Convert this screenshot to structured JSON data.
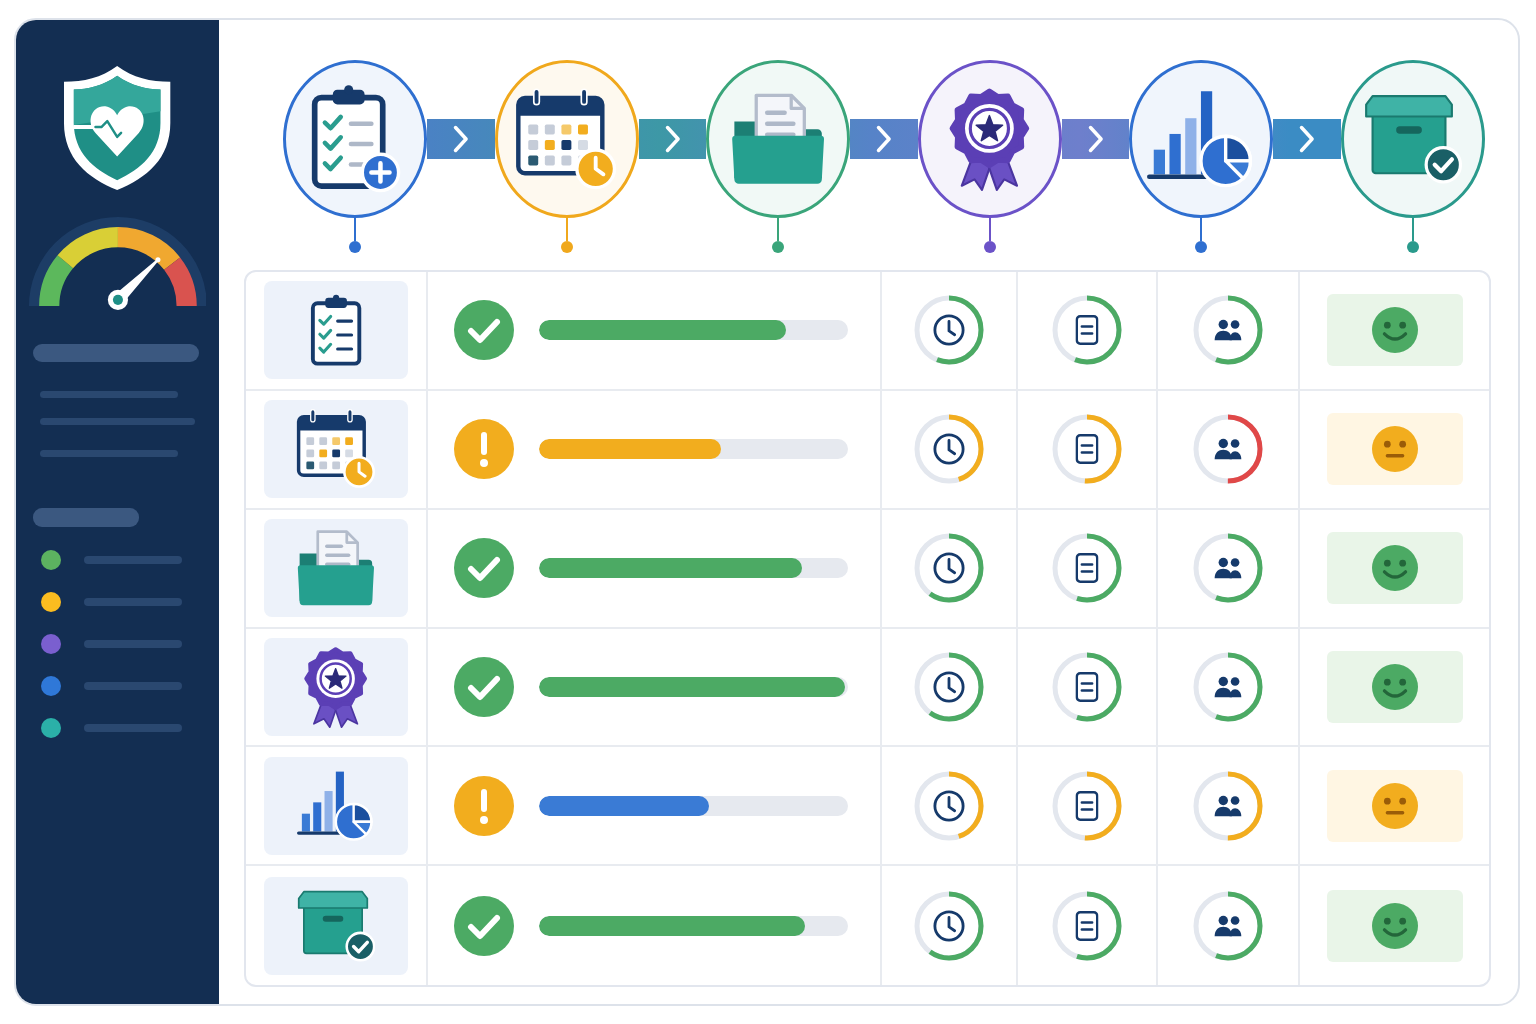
{
  "sidebar": {
    "gauge": {
      "level": 0.75
    },
    "legend": [
      {
        "color": "#5cb260"
      },
      {
        "color": "#fbbc20"
      },
      {
        "color": "#7a5fcf"
      },
      {
        "color": "#2f78d8"
      },
      {
        "color": "#2bb0a8"
      }
    ]
  },
  "pipeline": {
    "steps": [
      {
        "kind": "clipboard",
        "color": "#2f6fd0"
      },
      {
        "kind": "calendar",
        "color": "#f0a81c"
      },
      {
        "kind": "folder",
        "color": "#3aa57a"
      },
      {
        "kind": "award",
        "color": "#6b52c8"
      },
      {
        "kind": "chart",
        "color": "#2f6fd0"
      },
      {
        "kind": "archive",
        "color": "#2a9a8c"
      }
    ]
  },
  "table": {
    "rows": [
      {
        "icon": {
          "kind": "clipboard"
        },
        "status": {
          "kind": "check"
        },
        "progress": {
          "level": 0.8,
          "color": "#4caa64"
        },
        "rings": [
          {
            "kind": "clock",
            "level": 0.56,
            "color": "#4caa64"
          },
          {
            "kind": "document",
            "level": 0.56,
            "color": "#4caa64"
          },
          {
            "kind": "people",
            "level": 0.56,
            "color": "#4caa64"
          }
        ],
        "mood": {
          "kind": "happy"
        }
      },
      {
        "icon": {
          "kind": "calendar"
        },
        "status": {
          "kind": "alert"
        },
        "progress": {
          "level": 0.59,
          "color": "#f2ad1e"
        },
        "rings": [
          {
            "kind": "clock",
            "level": 0.45,
            "color": "#f2ad1e"
          },
          {
            "kind": "document",
            "level": 0.51,
            "color": "#f2ad1e"
          },
          {
            "kind": "people",
            "level": 0.5,
            "color": "#e04848"
          }
        ],
        "mood": {
          "kind": "neutral"
        }
      },
      {
        "icon": {
          "kind": "folder"
        },
        "status": {
          "kind": "check"
        },
        "progress": {
          "level": 0.85,
          "color": "#4caa64"
        },
        "rings": [
          {
            "kind": "clock",
            "level": 0.6,
            "color": "#4caa64"
          },
          {
            "kind": "document",
            "level": 0.55,
            "color": "#4caa64"
          },
          {
            "kind": "people",
            "level": 0.56,
            "color": "#4caa64"
          }
        ],
        "mood": {
          "kind": "happy"
        }
      },
      {
        "icon": {
          "kind": "award"
        },
        "status": {
          "kind": "check"
        },
        "progress": {
          "level": 0.99,
          "color": "#4caa64"
        },
        "rings": [
          {
            "kind": "clock",
            "level": 0.6,
            "color": "#4caa64"
          },
          {
            "kind": "document",
            "level": 0.55,
            "color": "#4caa64"
          },
          {
            "kind": "people",
            "level": 0.56,
            "color": "#4caa64"
          }
        ],
        "mood": {
          "kind": "happy"
        }
      },
      {
        "icon": {
          "kind": "chart"
        },
        "status": {
          "kind": "alert"
        },
        "progress": {
          "level": 0.55,
          "color": "#3a7bd5"
        },
        "rings": [
          {
            "kind": "clock",
            "level": 0.45,
            "color": "#f2ad1e"
          },
          {
            "kind": "document",
            "level": 0.51,
            "color": "#f2ad1e"
          },
          {
            "kind": "people",
            "level": 0.5,
            "color": "#f2ad1e"
          }
        ],
        "mood": {
          "kind": "neutral"
        }
      },
      {
        "icon": {
          "kind": "archive"
        },
        "status": {
          "kind": "check"
        },
        "progress": {
          "level": 0.86,
          "color": "#4caa64"
        },
        "rings": [
          {
            "kind": "clock",
            "level": 0.6,
            "color": "#4caa64"
          },
          {
            "kind": "document",
            "level": 0.55,
            "color": "#4caa64"
          },
          {
            "kind": "people",
            "level": 0.56,
            "color": "#4caa64"
          }
        ],
        "mood": {
          "kind": "happy"
        }
      }
    ]
  }
}
